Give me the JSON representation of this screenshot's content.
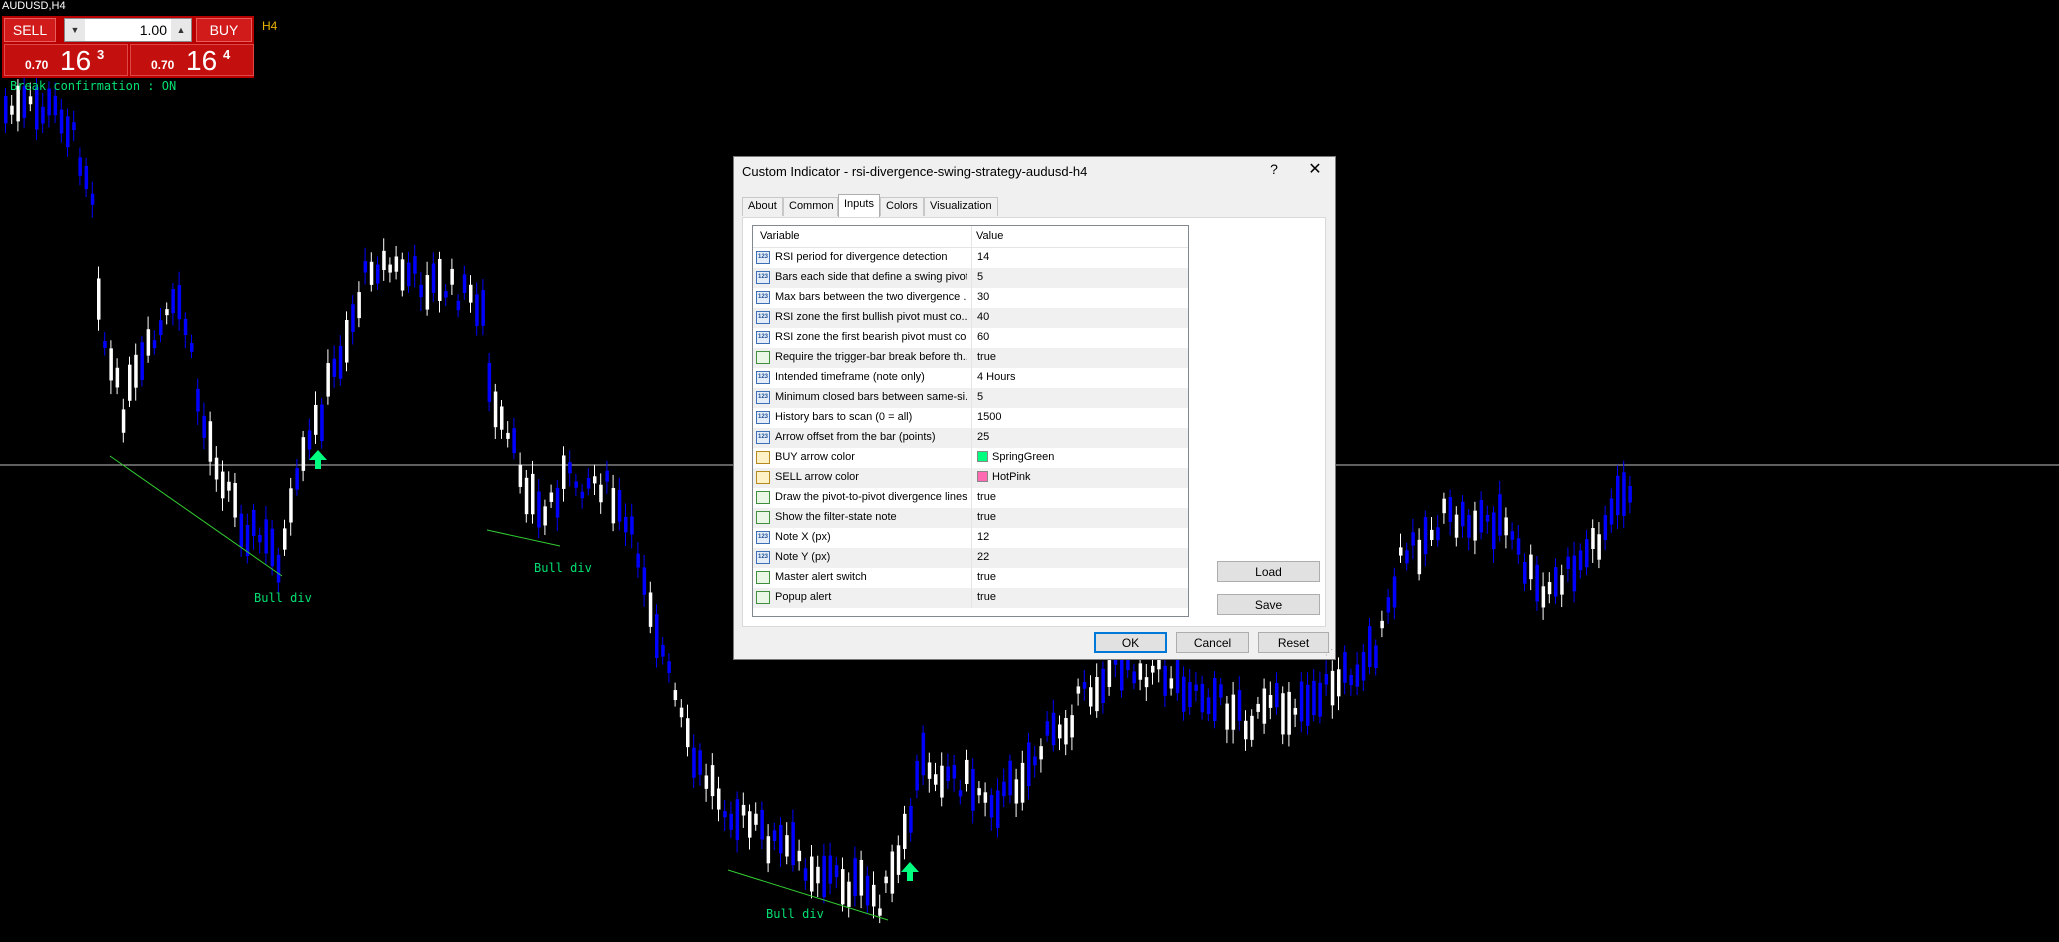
{
  "chart": {
    "symbol": "AUDUSD,H4",
    "symbol_tail": "H4",
    "break_note": "Break confirmation : ON",
    "bull_label": "Bull div",
    "colors": {
      "bull": "#ffffff",
      "bear": "#0000ff",
      "divergence_line": "#32cd32",
      "buy_arrow": "#00ff7f",
      "label": "#00e070",
      "price_line": "#c0c0c0"
    }
  },
  "trade_panel": {
    "sell_label": "SELL",
    "buy_label": "BUY",
    "lot_value": "1.00",
    "spin_down": "▼",
    "spin_up": "▲",
    "sell_price_small": "0.70",
    "sell_price_big": "16",
    "sell_price_sup": "3",
    "buy_price_small": "0.70",
    "buy_price_big": "16",
    "buy_price_sup": "4"
  },
  "dialog": {
    "title": "Custom Indicator - rsi-divergence-swing-strategy-audusd-h4",
    "help": "?",
    "close": "✕",
    "tabs": [
      "About",
      "Common",
      "Inputs",
      "Colors",
      "Visualization"
    ],
    "active_tab": "Inputs",
    "columns": {
      "variable": "Variable",
      "value": "Value"
    },
    "rows": [
      {
        "icon": "123",
        "var": "RSI period for divergence detection",
        "val": "14"
      },
      {
        "icon": "123",
        "var": "Bars each side that define a swing pivot",
        "val": "5"
      },
      {
        "icon": "123",
        "var": "Max bars between the two divergence ...",
        "val": "30"
      },
      {
        "icon": "123",
        "var": "RSI zone the first bullish pivot must co...",
        "val": "40"
      },
      {
        "icon": "123",
        "var": "RSI zone the first bearish pivot must co...",
        "val": "60"
      },
      {
        "icon": "bool",
        "var": "Require the trigger-bar break before th...",
        "val": "true"
      },
      {
        "icon": "123",
        "var": "Intended timeframe (note only)",
        "val": "4 Hours"
      },
      {
        "icon": "123",
        "var": "Minimum closed bars between same-si...",
        "val": "5"
      },
      {
        "icon": "123",
        "var": "History bars to scan (0 = all)",
        "val": "1500"
      },
      {
        "icon": "123",
        "var": "Arrow offset from the bar (points)",
        "val": "25"
      },
      {
        "icon": "color",
        "var": "BUY arrow color",
        "val": "SpringGreen",
        "swatch": "#00ff7f"
      },
      {
        "icon": "color",
        "var": "SELL arrow color",
        "val": "HotPink",
        "swatch": "#ff69b4"
      },
      {
        "icon": "bool",
        "var": "Draw the pivot-to-pivot divergence lines",
        "val": "true"
      },
      {
        "icon": "bool",
        "var": "Show the filter-state note",
        "val": "true"
      },
      {
        "icon": "123",
        "var": "Note X (px)",
        "val": "12"
      },
      {
        "icon": "123",
        "var": "Note Y (px)",
        "val": "22"
      },
      {
        "icon": "bool",
        "var": "Master alert switch",
        "val": "true"
      },
      {
        "icon": "bool",
        "var": "Popup alert",
        "val": "true"
      }
    ],
    "buttons": {
      "load": "Load",
      "save": "Save",
      "ok": "OK",
      "cancel": "Cancel",
      "reset": "Reset"
    }
  }
}
